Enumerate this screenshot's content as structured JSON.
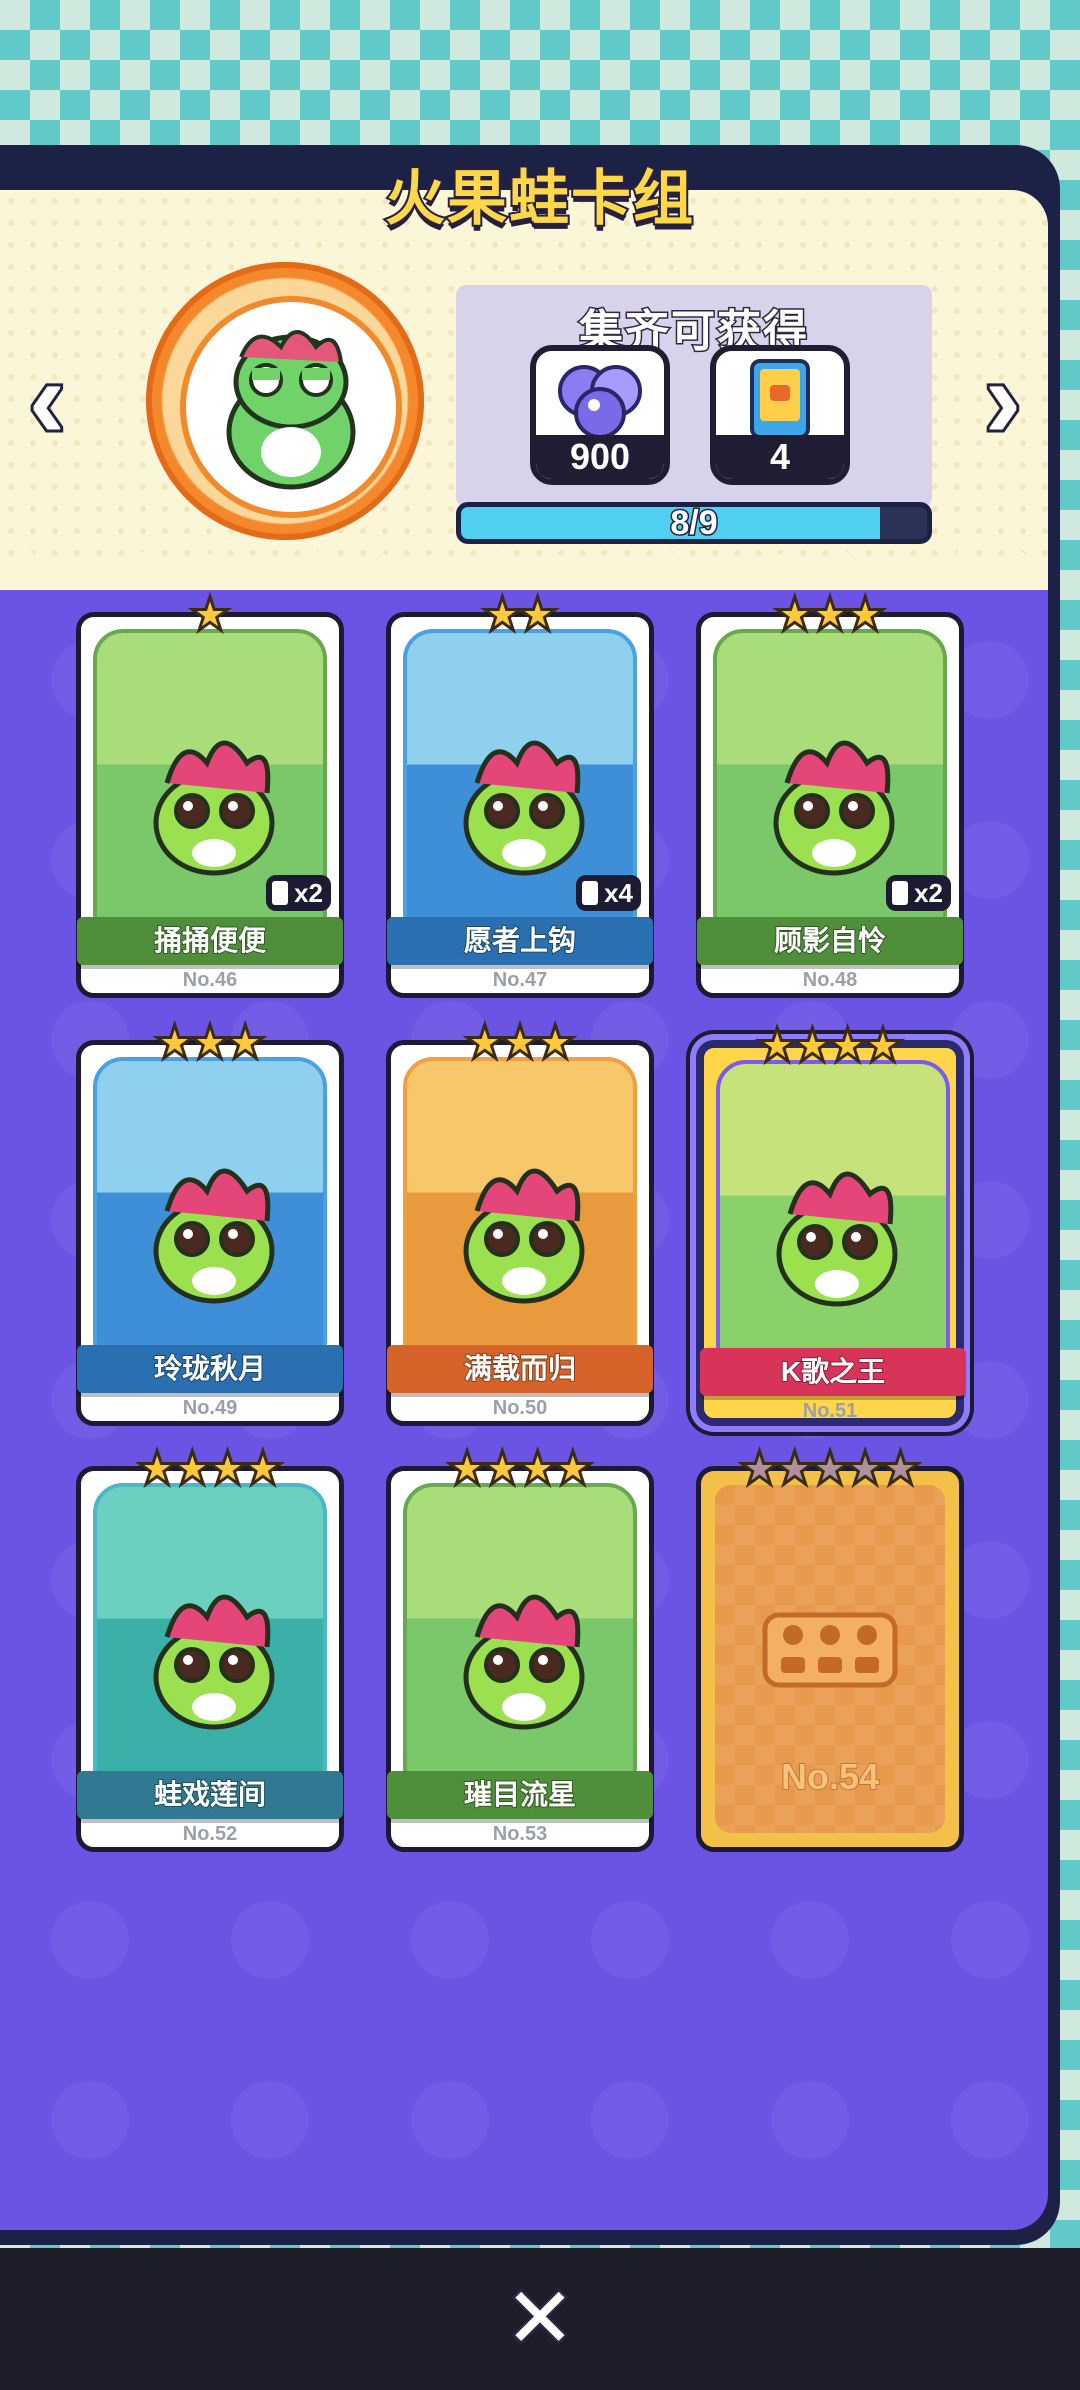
{
  "header": {
    "title": "火果蛙卡组"
  },
  "nav": {
    "prev_icon": "chevron-left-icon",
    "next_icon": "chevron-right-icon"
  },
  "reward": {
    "title": "集齐可获得",
    "items": [
      {
        "icon": "gem-orbs-icon",
        "count": "900"
      },
      {
        "icon": "card-pack-icon",
        "count": "4"
      }
    ],
    "progress_text": "8/9",
    "progress_fraction": 0.9
  },
  "cards": [
    {
      "name": "捅捅便便",
      "no": "No.46",
      "stars": 1,
      "dup": "x2",
      "theme": "green"
    },
    {
      "name": "愿者上钩",
      "no": "No.47",
      "stars": 2,
      "dup": "x4",
      "theme": "blue"
    },
    {
      "name": "顾影自怜",
      "no": "No.48",
      "stars": 3,
      "dup": "x2",
      "theme": "green"
    },
    {
      "name": "玲珑秋月",
      "no": "No.49",
      "stars": 3,
      "dup": "",
      "theme": "blue"
    },
    {
      "name": "满载而归",
      "no": "No.50",
      "stars": 3,
      "dup": "",
      "theme": "orange"
    },
    {
      "name": "K歌之王",
      "no": "No.51",
      "stars": 4,
      "dup": "",
      "theme": "special"
    },
    {
      "name": "蛙戏莲间",
      "no": "No.52",
      "stars": 4,
      "dup": "",
      "theme": "teal"
    },
    {
      "name": "璀目流星",
      "no": "No.53",
      "stars": 4,
      "dup": "",
      "theme": "green"
    },
    {
      "name": "",
      "no": "No.54",
      "stars": 5,
      "dup": "",
      "theme": "locked"
    }
  ],
  "footer": {
    "close_icon": "close-icon"
  }
}
